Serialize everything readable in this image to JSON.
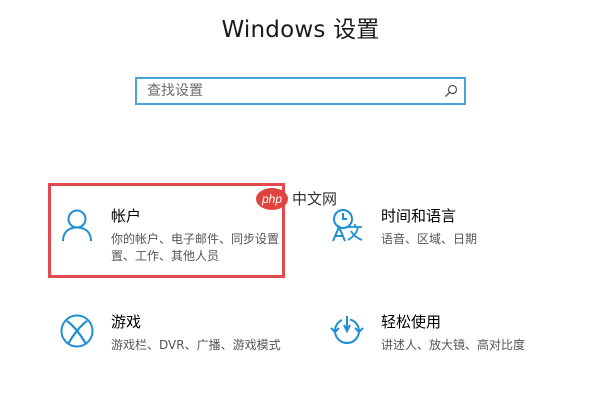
{
  "header": {
    "title": "Windows 设置"
  },
  "search": {
    "placeholder": "查找设置"
  },
  "tiles": [
    {
      "name": "帐户",
      "description_line1": "你的帐户、电子邮件、同步设置",
      "description_line2": "置、工作、其他人员",
      "icon": "person-icon"
    },
    {
      "name": "时间和语言",
      "description_line1": "语音、区域、日期",
      "description_line2": "",
      "icon": "time-language-icon"
    },
    {
      "name": "游戏",
      "description_line1": "游戏栏、DVR、广播、游戏模式",
      "description_line2": "",
      "icon": "xbox-icon"
    },
    {
      "name": "轻松使用",
      "description_line1": "讲述人、放大镜、高对比度",
      "description_line2": "",
      "icon": "ease-of-access-icon"
    }
  ],
  "watermark": {
    "text_php": "php",
    "text_cn": "中文网"
  },
  "colors": {
    "accent": "#1e8fd3",
    "highlight": "#e14a4f",
    "search_border": "#4ba3d8"
  }
}
